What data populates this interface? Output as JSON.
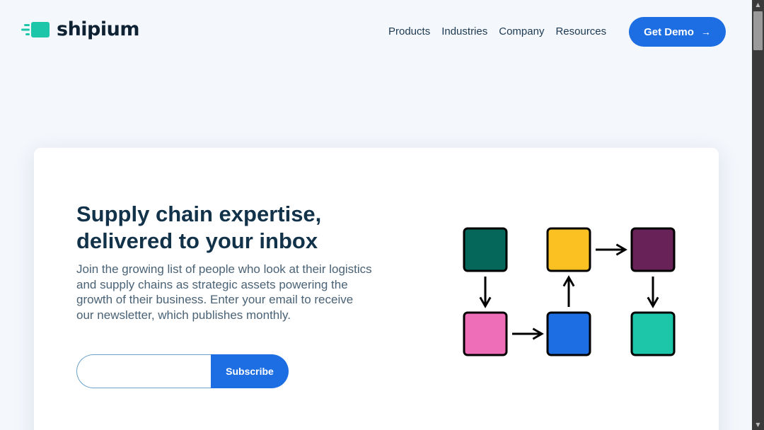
{
  "header": {
    "logo_text": "shipium",
    "nav": [
      "Products",
      "Industries",
      "Company",
      "Resources"
    ],
    "cta_label": "Get Demo",
    "cta_icon": "arrow-right-icon"
  },
  "colors": {
    "brand_teal": "#1ec6a9",
    "primary_blue": "#1d6ee2",
    "tile_dark_green": "#05675a",
    "tile_yellow": "#fbc123",
    "tile_purple": "#682258",
    "tile_pink": "#ee6eb7",
    "tile_blue": "#1d6ee2",
    "tile_teal": "#1ec6a9"
  },
  "newsletter": {
    "headline_line1": "Supply chain expertise,",
    "headline_line2": "delivered to your inbox",
    "body": "Join the growing list of people who look at their logistics and supply chains as strategic assets powering the growth of their business. Enter your email to receive our newsletter, which publishes monthly.",
    "email_value": "",
    "email_placeholder": "",
    "subscribe_label": "Subscribe"
  }
}
